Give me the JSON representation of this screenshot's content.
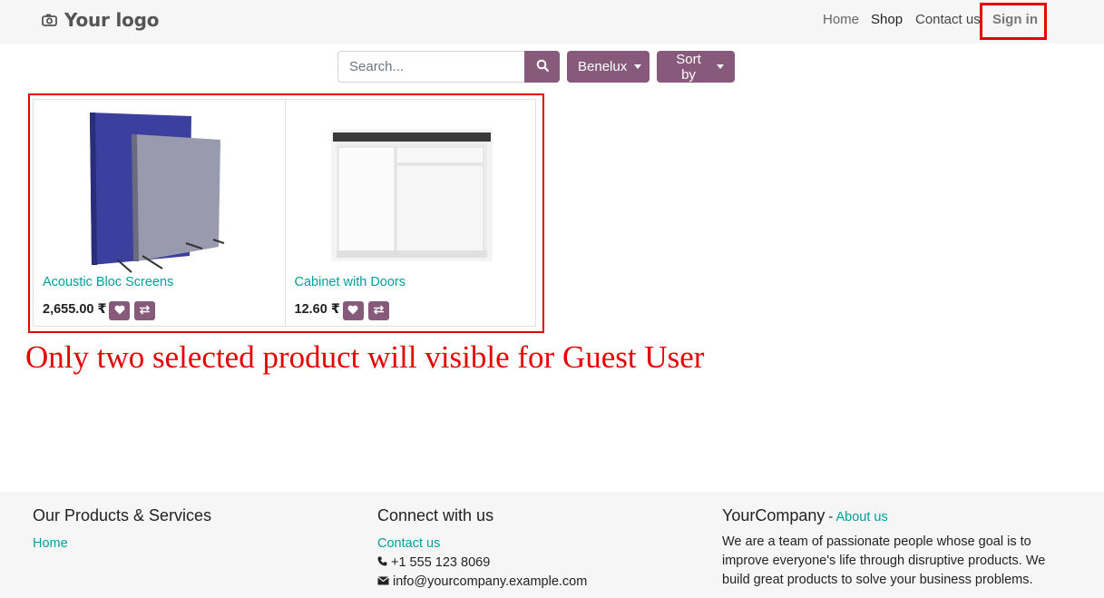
{
  "header": {
    "logo_text": "Your logo",
    "nav": {
      "home": "Home",
      "shop": "Shop",
      "contact": "Contact us",
      "signin": "Sign in"
    }
  },
  "toolbar": {
    "search_placeholder": "Search...",
    "pricelist_label": "Benelux",
    "sort_label": "Sort by"
  },
  "products": [
    {
      "name": "Acoustic Bloc Screens",
      "price": "2,655.00 ₹"
    },
    {
      "name": "Cabinet with Doors",
      "price": "12.60 ₹"
    }
  ],
  "annotation": {
    "text": "Only two selected product will visible for Guest User",
    "color": "#e60000"
  },
  "footer": {
    "col1": {
      "heading": "Our Products & Services",
      "links": [
        "Home"
      ]
    },
    "col2": {
      "heading": "Connect with us",
      "contact_link": "Contact us",
      "phone": "+1 555 123 8069",
      "email": "info@yourcompany.example.com"
    },
    "col3": {
      "company": "YourCompany",
      "separator": " - ",
      "about_link": "About us",
      "description": "We are a team of passionate people whose goal is to improve everyone's life through disruptive products. We build great products to solve your business problems."
    }
  },
  "colors": {
    "primary": "#875a7b",
    "link": "#00a09d",
    "annotation": "#e60000"
  },
  "icons": [
    "camera-icon",
    "search-icon",
    "heart-icon",
    "compare-icon",
    "phone-icon",
    "envelope-icon"
  ]
}
